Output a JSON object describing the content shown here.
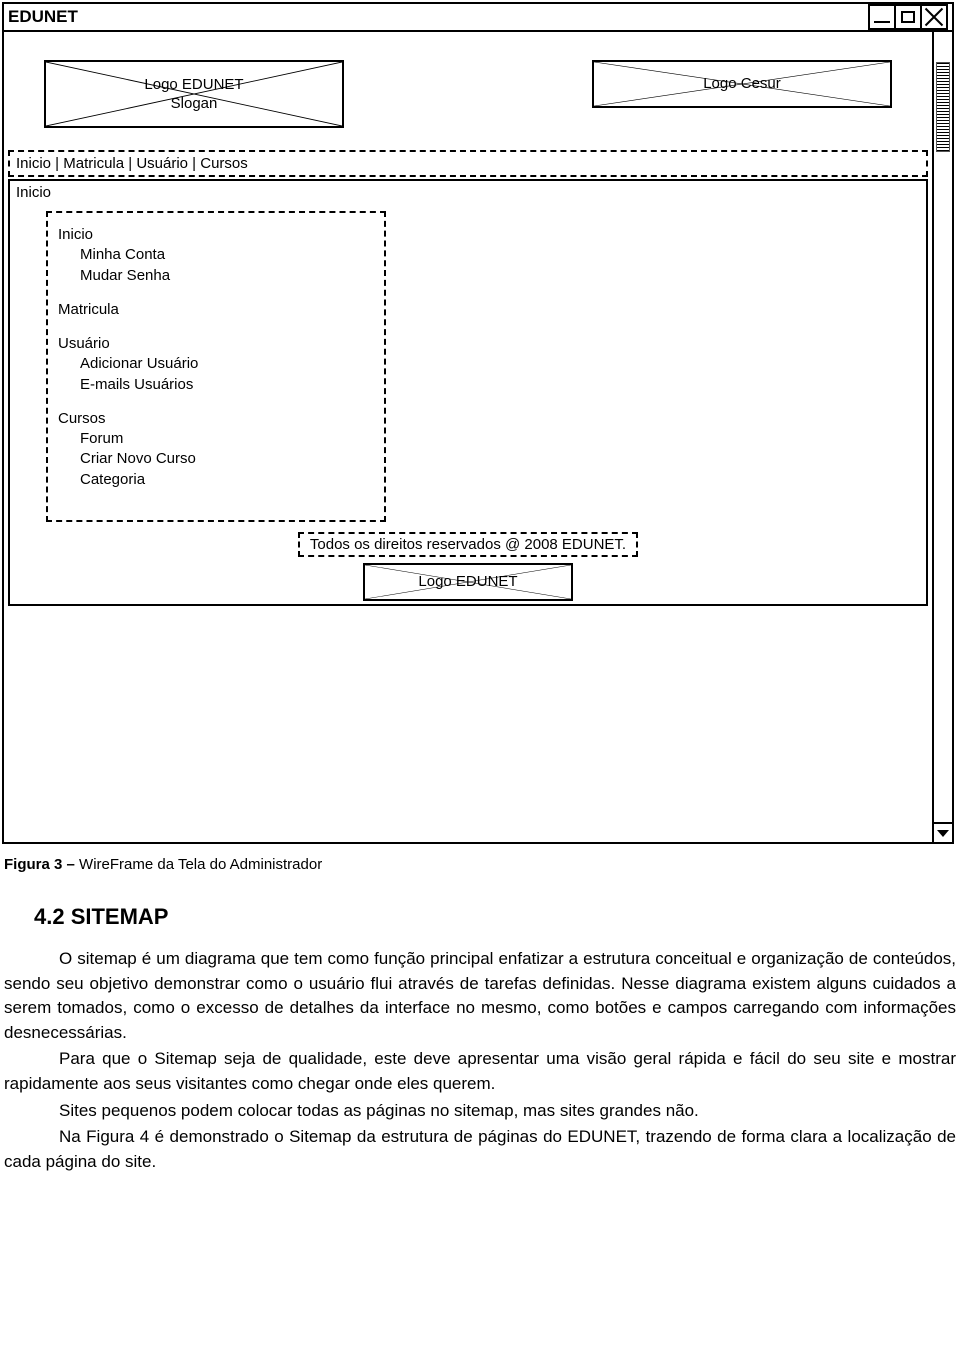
{
  "window": {
    "title": "EDUNET"
  },
  "header": {
    "logo1_text": "Logo EDUNET\nSlogan",
    "logo2_text": "Logo Cesur"
  },
  "nav": {
    "items_joined": "Inicio | Matricula | Usuário | Cursos"
  },
  "subnav": {
    "label": "Inicio"
  },
  "sidebar": {
    "s1_title": "Inicio",
    "s1_a": "Minha Conta",
    "s1_b": "Mudar Senha",
    "s2_title": "Matricula",
    "s3_title": "Usuário",
    "s3_a": "Adicionar Usuário",
    "s3_b": "E-mails Usuários",
    "s4_title": "Cursos",
    "s4_a": "Forum",
    "s4_b": "Criar Novo Curso",
    "s4_c": "Categoria"
  },
  "footer": {
    "copyright": "Todos os direitos reservados @ 2008 EDUNET.",
    "logo_text": "Logo EDUNET"
  },
  "caption": {
    "label": "Figura 3 – ",
    "text": "WireFrame da Tela do Administrador"
  },
  "doc": {
    "heading": "4.2 SITEMAP",
    "p1": "O sitemap é um diagrama que tem como função principal enfatizar a estrutura conceitual e organização de conteúdos, sendo seu objetivo demonstrar como o usuário flui através de tarefas definidas. Nesse diagrama existem alguns cuidados a serem tomados, como o excesso de detalhes da interface no mesmo, como botões e campos carregando com informações desnecessárias.",
    "p2": "Para que o Sitemap seja de qualidade, este deve apresentar uma visão geral rápida e fácil do seu site e mostrar rapidamente aos seus visitantes como chegar onde eles querem.",
    "p3": "Sites pequenos podem colocar todas as páginas no sitemap, mas sites grandes não.",
    "p4": "Na Figura 4 é demonstrado o Sitemap da estrutura de páginas do EDUNET, trazendo de forma clara a localização de cada página do site."
  }
}
